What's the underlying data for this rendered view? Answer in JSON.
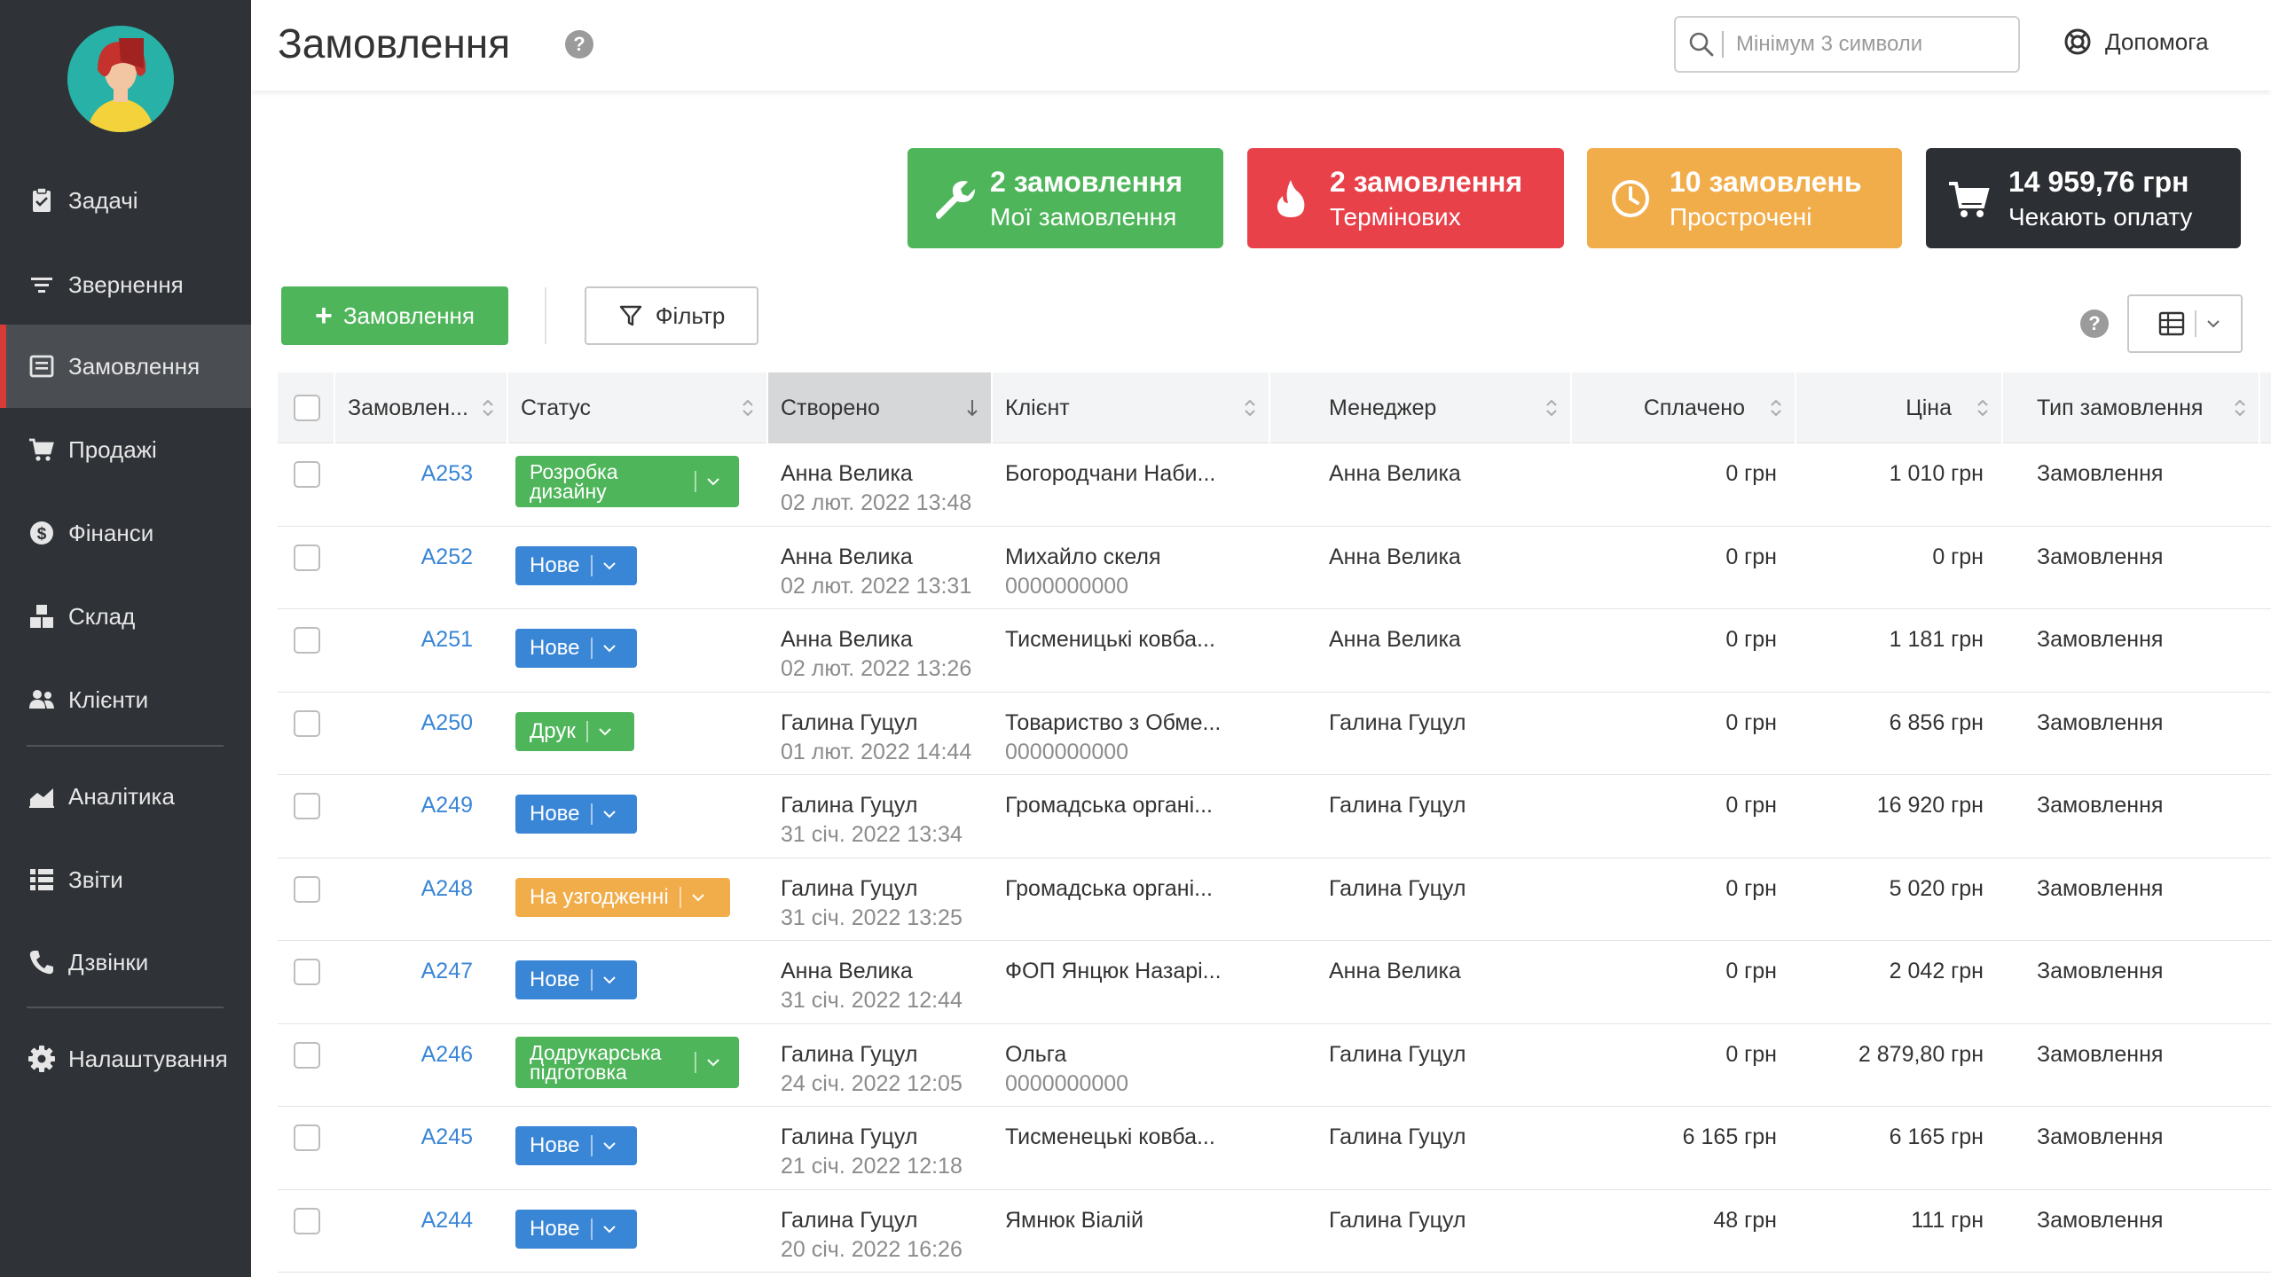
{
  "nav": {
    "items": [
      {
        "key": "tasks",
        "label": "Задачі",
        "icon": "clipboard-check-icon"
      },
      {
        "key": "requests",
        "label": "Звернення",
        "icon": "filter-lines-icon"
      },
      {
        "key": "orders",
        "label": "Замовлення",
        "icon": "order-list-icon",
        "active": true
      },
      {
        "key": "sales",
        "label": "Продажі",
        "icon": "cart-icon"
      },
      {
        "key": "finance",
        "label": "Фінанси",
        "icon": "dollar-circle-icon"
      },
      {
        "key": "warehouse",
        "label": "Склад",
        "icon": "boxes-icon"
      },
      {
        "key": "clients",
        "label": "Клієнти",
        "icon": "users-icon"
      },
      {
        "key": "analytics",
        "label": "Аналітика",
        "icon": "area-chart-icon"
      },
      {
        "key": "reports",
        "label": "Звіти",
        "icon": "list-icon"
      },
      {
        "key": "calls",
        "label": "Дзвінки",
        "icon": "phone-icon"
      },
      {
        "key": "settings",
        "label": "Налаштування",
        "icon": "gear-icon"
      }
    ]
  },
  "header": {
    "title": "Замовлення",
    "help_mark": "?",
    "search_placeholder": "Мінімум 3 символи",
    "help_link": "Допомога"
  },
  "cards": [
    {
      "title": "2 замовлення",
      "subtitle": "Мої замовлення",
      "color": "#4fb55a",
      "icon": "wrench-icon"
    },
    {
      "title": "2 замовлення",
      "subtitle": "Термінових",
      "color": "#e8414a",
      "icon": "fire-icon"
    },
    {
      "title": "10 замовлень",
      "subtitle": "Прострочені",
      "color": "#f2ad4b",
      "icon": "clock-icon"
    },
    {
      "title": "14 959,76 грн",
      "subtitle": "Чекають оплату",
      "color": "#2c2f33",
      "icon": "cart-icon"
    }
  ],
  "toolbar": {
    "add_label": "Замовлення",
    "add_plus": "+",
    "filter_label": "Фільтр",
    "help_mark": "?"
  },
  "table": {
    "columns": [
      "Замовлен...",
      "Статус",
      "Створено",
      "Клієнт",
      "Менеджер",
      "Сплачено",
      "Ціна",
      "Тип замовлення"
    ],
    "rows": [
      {
        "num": "A253",
        "status": "Розробка дизайну",
        "status_color": "#4fb55a",
        "big": true,
        "creator": "Анна Велика",
        "created": "02 лют. 2022 13:48",
        "client": "Богородчани Наби...",
        "client_phone": "",
        "manager": "Анна Велика",
        "paid": "0 грн",
        "price": "1 010 грн",
        "type": "Замовлення"
      },
      {
        "num": "A252",
        "status": "Нове",
        "status_color": "#3a86d6",
        "creator": "Анна Велика",
        "created": "02 лют. 2022 13:31",
        "client": "Михайло скеля",
        "client_phone": "0000000000",
        "manager": "Анна Велика",
        "paid": "0 грн",
        "price": "0 грн",
        "type": "Замовлення"
      },
      {
        "num": "A251",
        "status": "Нове",
        "status_color": "#3a86d6",
        "creator": "Анна Велика",
        "created": "02 лют. 2022 13:26",
        "client": "Тисменицькі ковба...",
        "client_phone": "",
        "manager": "Анна Велика",
        "paid": "0 грн",
        "price": "1 181 грн",
        "type": "Замовлення"
      },
      {
        "num": "A250",
        "status": "Друк",
        "status_color": "#4fb55a",
        "creator": "Галина Гуцул",
        "created": "01 лют. 2022 14:44",
        "client": "Товариство з Обме...",
        "client_phone": "0000000000",
        "manager": "Галина Гуцул",
        "paid": "0 грн",
        "price": "6 856 грн",
        "type": "Замовлення"
      },
      {
        "num": "A249",
        "status": "Нове",
        "status_color": "#3a86d6",
        "creator": "Галина Гуцул",
        "created": "31 січ. 2022 13:34",
        "client": "Громадська органі...",
        "client_phone": "",
        "manager": "Галина Гуцул",
        "paid": "0 грн",
        "price": "16 920 грн",
        "type": "Замовлення"
      },
      {
        "num": "A248",
        "status": "На узгодженні",
        "status_color": "#f2ad4b",
        "creator": "Галина Гуцул",
        "created": "31 січ. 2022 13:25",
        "client": "Громадська органі...",
        "client_phone": "",
        "manager": "Галина Гуцул",
        "paid": "0 грн",
        "price": "5 020 грн",
        "type": "Замовлення"
      },
      {
        "num": "A247",
        "status": "Нове",
        "status_color": "#3a86d6",
        "creator": "Анна Велика",
        "created": "31 січ. 2022 12:44",
        "client": "ФОП Янцюк Назарі...",
        "client_phone": "",
        "manager": "Анна Велика",
        "paid": "0 грн",
        "price": "2 042 грн",
        "type": "Замовлення"
      },
      {
        "num": "A246",
        "status": "Додрукарська підготовка",
        "status_color": "#4fb55a",
        "big": true,
        "creator": "Галина Гуцул",
        "created": "24 січ. 2022 12:05",
        "client": "Ольга",
        "client_phone": "0000000000",
        "manager": "Галина Гуцул",
        "paid": "0 грн",
        "price": "2 879,80 грн",
        "type": "Замовлення"
      },
      {
        "num": "A245",
        "status": "Нове",
        "status_color": "#3a86d6",
        "creator": "Галина Гуцул",
        "created": "21 січ. 2022 12:18",
        "client": "Тисменецькі ковба...",
        "client_phone": "",
        "manager": "Галина Гуцул",
        "paid": "6 165 грн",
        "price": "6 165 грн",
        "type": "Замовлення"
      },
      {
        "num": "A244",
        "status": "Нове",
        "status_color": "#3a86d6",
        "creator": "Галина Гуцул",
        "created": "20 січ. 2022 16:26",
        "client": "Ямнюк Віалій",
        "client_phone": "",
        "manager": "Галина Гуцул",
        "paid": "48 грн",
        "price": "111 грн",
        "type": "Замовлення"
      }
    ]
  }
}
